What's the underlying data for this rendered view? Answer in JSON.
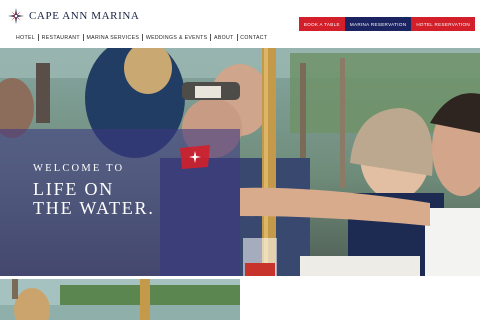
{
  "brand": {
    "name": "CAPE ANN MARINA"
  },
  "buttons": [
    {
      "label": "BOOK A TABLE",
      "color": "#d21f2a"
    },
    {
      "label": "MARINA RESERVATION",
      "color": "#1b2460"
    },
    {
      "label": "HOTEL RESERVATION",
      "color": "#d21f2a"
    }
  ],
  "nav": [
    {
      "label": "HOTEL"
    },
    {
      "label": "RESTAURANT"
    },
    {
      "label": "MARINA SERVICES"
    },
    {
      "label": "WEDDINGS & EVENTS"
    },
    {
      "label": "ABOUT"
    },
    {
      "label": "CONTACT"
    }
  ],
  "hero": {
    "welcome": "WELCOME TO",
    "headline": "LIFE ON\nTHE WATER."
  },
  "colors": {
    "brand_navy": "#1b2344",
    "accent_red": "#d21f2a",
    "overlay": "rgba(60,55,130,0.58)"
  }
}
